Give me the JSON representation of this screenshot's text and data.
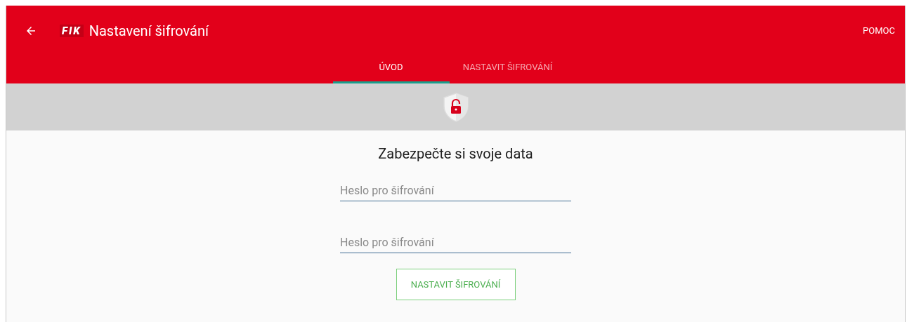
{
  "toolbar": {
    "logo": "FIK",
    "title": "Nastavení šifrování",
    "action": "POMOC"
  },
  "tabs": [
    {
      "label": "ÚVOD",
      "selected": true
    },
    {
      "label": "NASTAVIT ŠIFROVÁNÍ",
      "selected": false
    }
  ],
  "content": {
    "heading": "Zabezpečte si svoje data",
    "fields": [
      {
        "placeholder": "Heslo pro šifrování"
      },
      {
        "placeholder": "Heslo pro šifrování"
      }
    ],
    "button": "NASTAVIT ŠIFROVÁNÍ"
  }
}
